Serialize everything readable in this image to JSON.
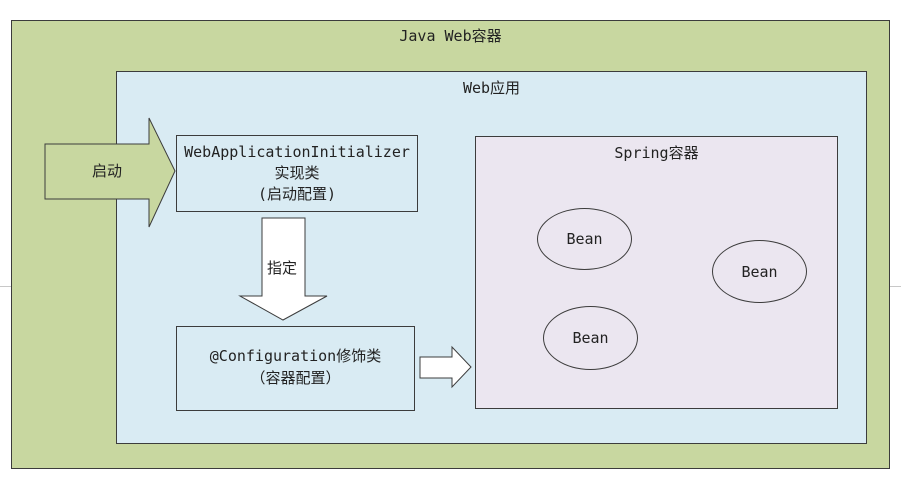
{
  "container": {
    "title": "Java Web容器"
  },
  "webapp": {
    "title": "Web应用"
  },
  "start_arrow": {
    "label": "启动"
  },
  "initializer": {
    "line1": "WebApplicationInitializer",
    "line2": "实现类",
    "line3": "(启动配置)"
  },
  "specify_arrow": {
    "label": "指定"
  },
  "configuration": {
    "line1": "@Configuration修饰类",
    "line2": "（容器配置）"
  },
  "spring": {
    "title": "Spring容器",
    "beans": [
      "Bean",
      "Bean",
      "Bean"
    ]
  },
  "colors": {
    "container_fill": "#c8d7a0",
    "webapp_fill": "#d9ebf3",
    "spring_fill": "#ebe6f0",
    "border": "#3c3c3c"
  }
}
